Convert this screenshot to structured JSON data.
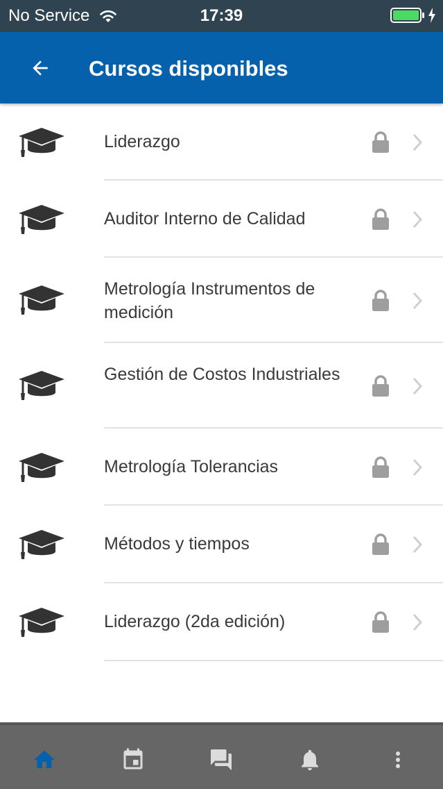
{
  "status_bar": {
    "carrier": "No Service",
    "time": "17:39",
    "battery_color": "#4cd964"
  },
  "app_bar": {
    "title": "Cursos disponibles",
    "background": "#0561ac",
    "back_icon": "arrow-left-icon"
  },
  "courses": [
    {
      "label": "Liderazgo",
      "locked": true
    },
    {
      "label": "Auditor Interno de Calidad",
      "locked": true
    },
    {
      "label": "Metrología Instrumentos de medición",
      "locked": true
    },
    {
      "label": "Gestión de Costos Industriales",
      "locked": true
    },
    {
      "label": "Metrología Tolerancias",
      "locked": true
    },
    {
      "label": "Métodos y tiempos",
      "locked": true
    },
    {
      "label": "Liderazgo (2da edición)",
      "locked": true
    }
  ],
  "bottom_nav": {
    "items": [
      {
        "icon": "home-icon",
        "active": true
      },
      {
        "icon": "calendar-icon",
        "active": false
      },
      {
        "icon": "forum-icon",
        "active": false
      },
      {
        "icon": "bell-icon",
        "active": false
      },
      {
        "icon": "more-vert-icon",
        "active": false
      }
    ],
    "active_color": "#0561ac",
    "inactive_color": "#dcdcdc"
  }
}
